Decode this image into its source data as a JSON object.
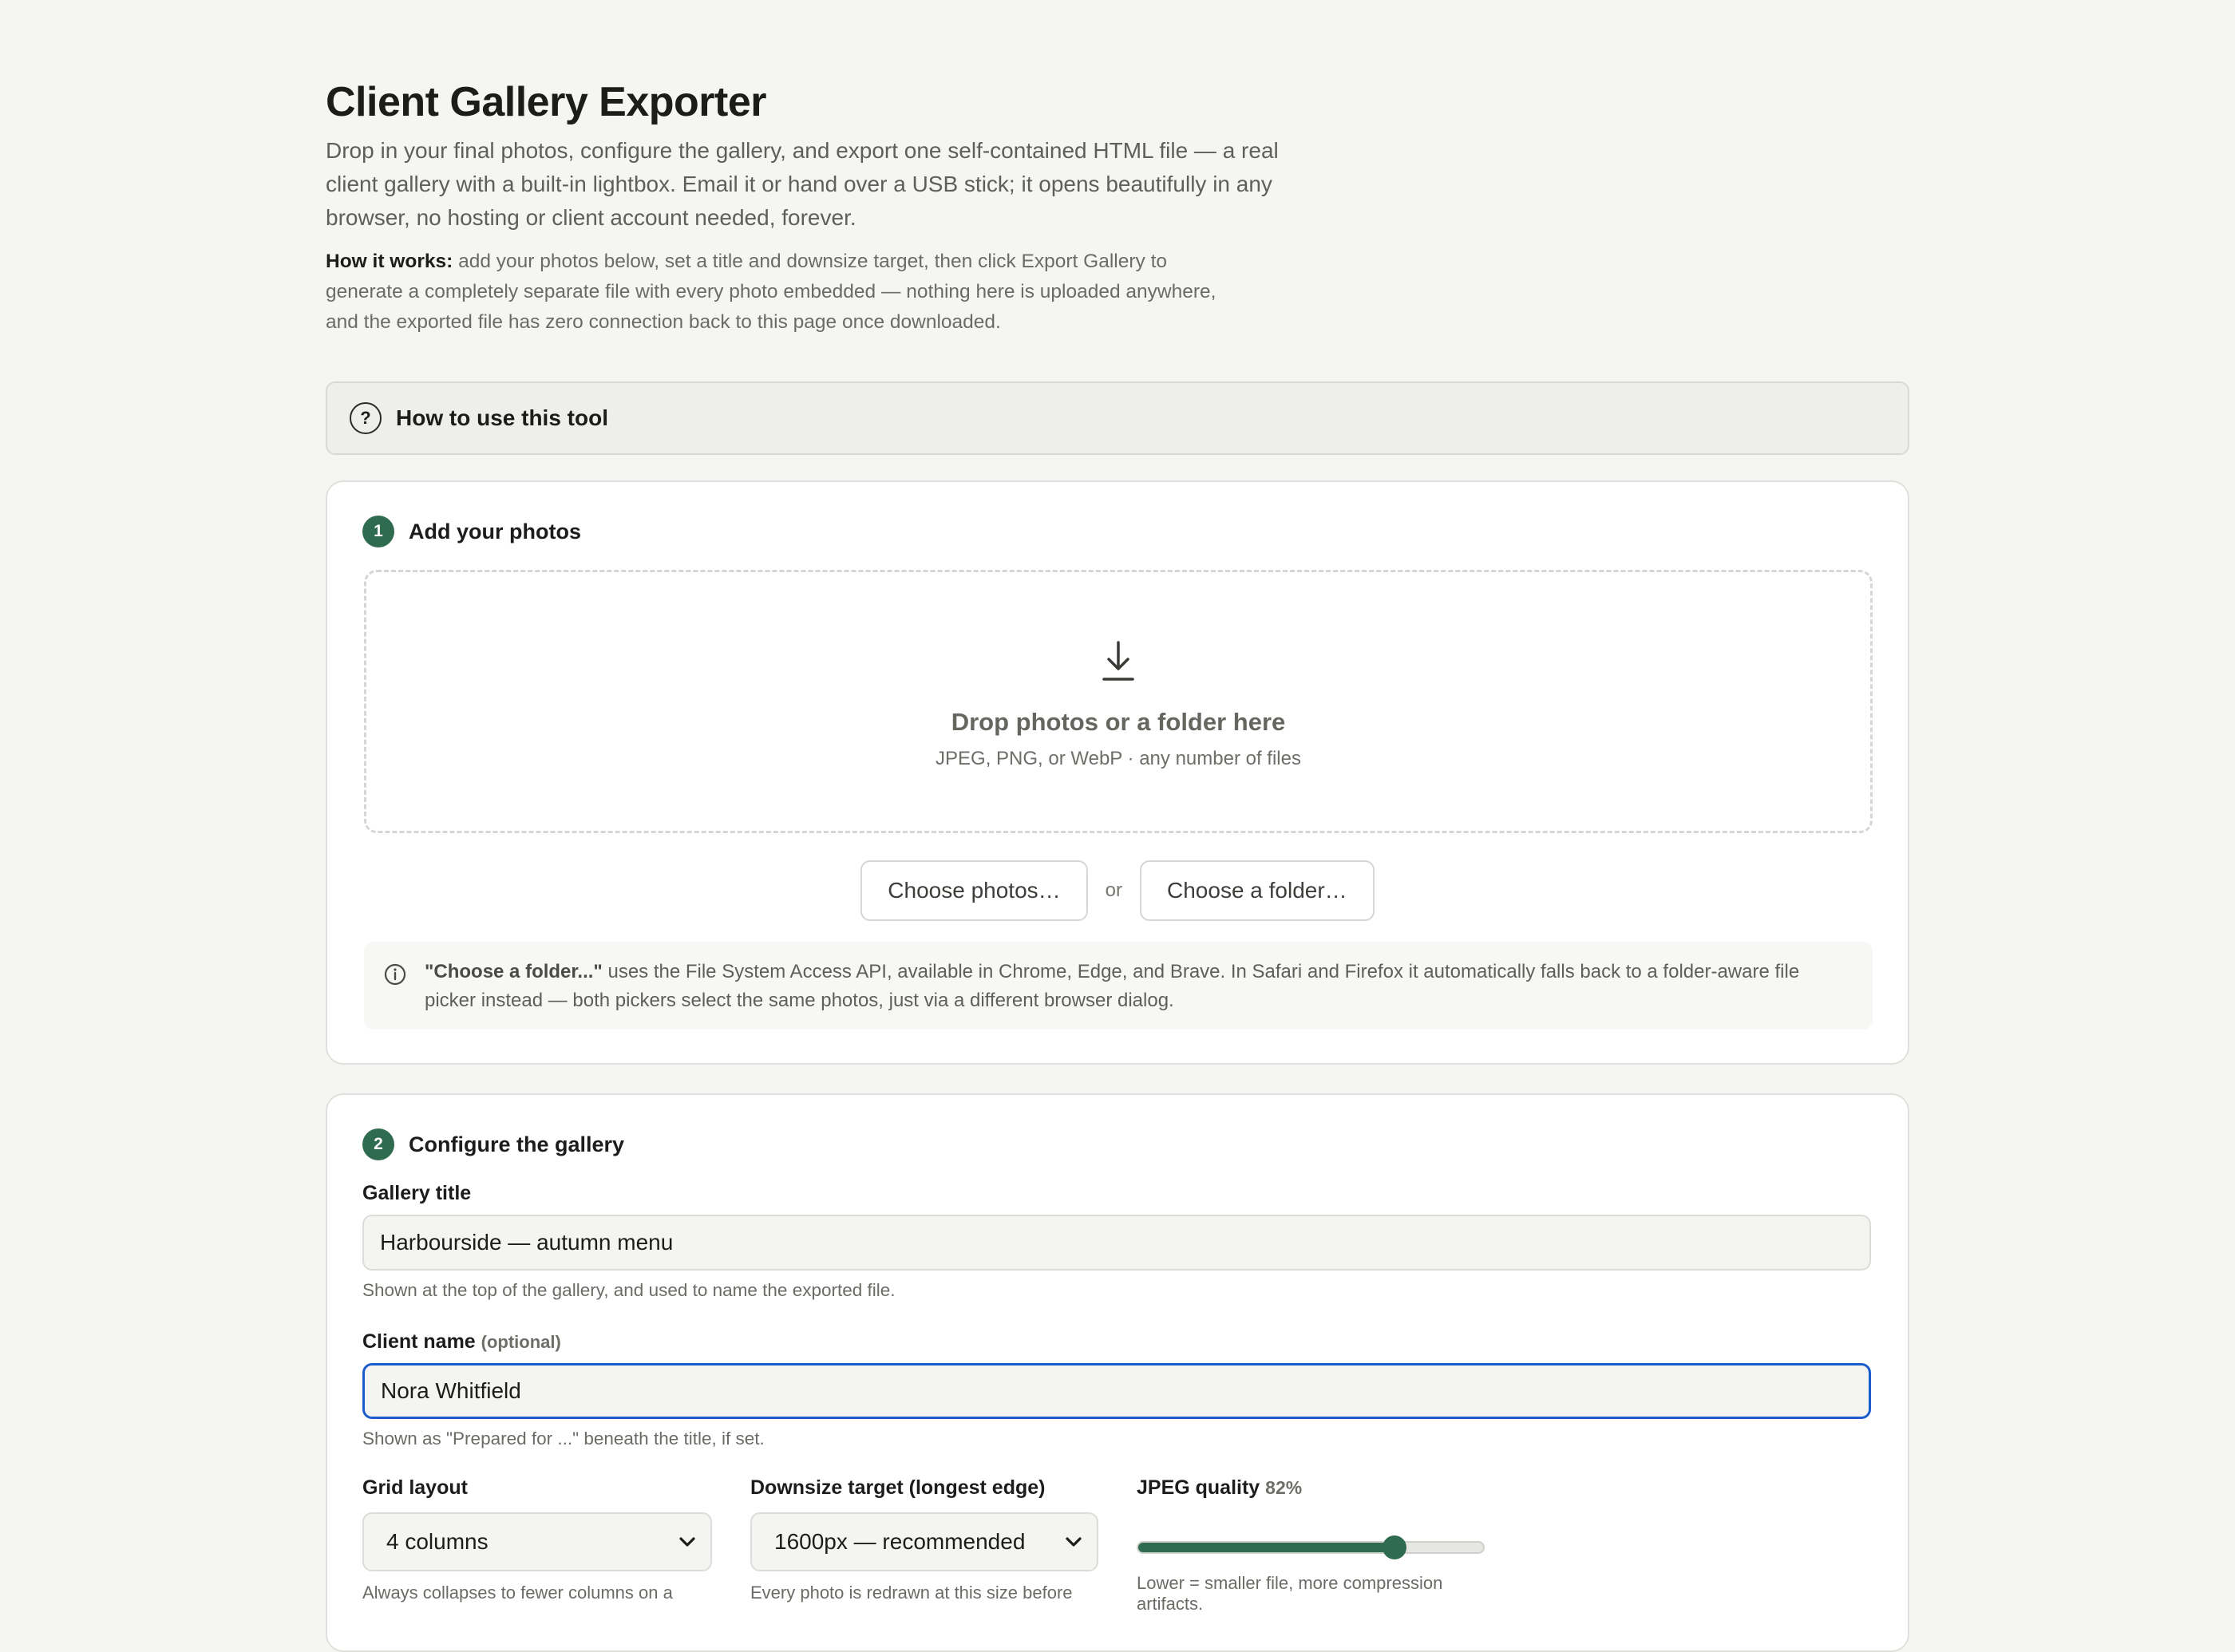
{
  "header": {
    "title": "Client Gallery Exporter",
    "lead": "Drop in your final photos, configure the gallery, and export one self-contained HTML file — a real client gallery with a built-in lightbox. Email it or hand over a USB stick; it opens beautifully in any browser, no hosting or client account needed, forever.",
    "how_label": "How it works:",
    "how_text": " add your photos below, set a title and downsize target, then click Export Gallery to generate a completely separate file with every photo embedded — nothing here is uploaded anywhere, and the exported file has zero connection back to this page once downloaded."
  },
  "accordion": {
    "icon": "help-circle-icon",
    "label": "How to use this tool"
  },
  "step1": {
    "number": "1",
    "title": "Add your photos",
    "drop_title": "Drop photos or a folder here",
    "drop_sub": "JPEG, PNG, or WebP · any number of files",
    "choose_photos": "Choose photos…",
    "or": "or",
    "choose_folder": "Choose a folder…",
    "info_bold": "\"Choose a folder...\"",
    "info_text": " uses the File System Access API, available in Chrome, Edge, and Brave. In Safari and Firefox it automatically falls back to a folder-aware file picker instead — both pickers select the same photos, just via a different browser dialog."
  },
  "step2": {
    "number": "2",
    "title": "Configure the gallery",
    "gallery_title_label": "Gallery title",
    "gallery_title_value": "Harbourside — autumn menu",
    "gallery_title_hint": "Shown at the top of the gallery, and used to name the exported file.",
    "client_label": "Client name",
    "client_optional": "(optional)",
    "client_value": "Nora Whitfield",
    "client_hint": "Shown as \"Prepared for ...\" beneath the title, if set.",
    "grid_label": "Grid layout",
    "grid_value": "4 columns",
    "grid_hint": "Always collapses to fewer columns on a",
    "downsize_label": "Downsize target (longest edge)",
    "downsize_value": "1600px — recommended",
    "downsize_hint": "Every photo is redrawn at this size before",
    "quality_label": "JPEG quality",
    "quality_value": "82%",
    "quality_percent": 82,
    "quality_hint": "Lower = smaller file, more compression artifacts."
  },
  "colors": {
    "accent": "#2f6b4f",
    "focus": "#1a5ccc"
  }
}
